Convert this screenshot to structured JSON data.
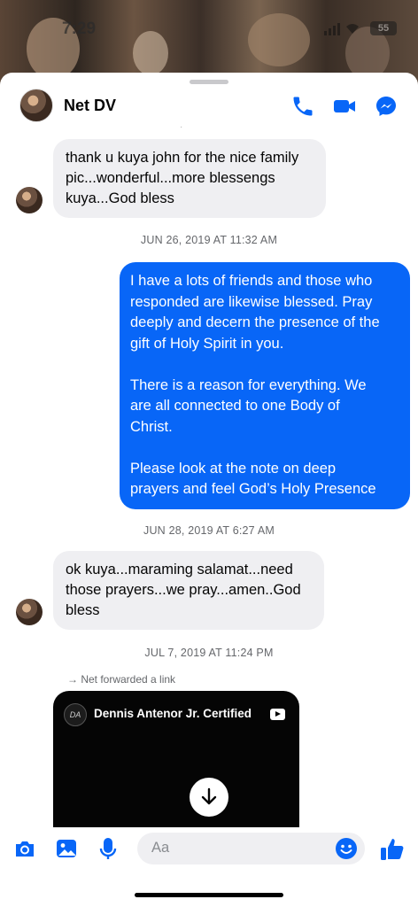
{
  "status_bar": {
    "time": "7:29",
    "battery": "55"
  },
  "header": {
    "contact_name": "Net DV"
  },
  "messages": {
    "m1": {
      "lines": [
        "thank u kuya john for the nice family",
        "pic...wonderful...more blessengs",
        "kuya...God bless"
      ]
    },
    "t1": "JUN 26, 2019 AT 11:32 AM",
    "m2": {
      "p1": [
        "I have a lots of friends and those who",
        "responded are likewise blessed. Pray",
        "deeply and decern the presence of the",
        "gift of Holy Spirit in you."
      ],
      "p2": [
        "There is a reason for everything. We",
        "are all connected to one Body of",
        "Christ."
      ],
      "p3": [
        "Please look at the note on deep",
        "prayers and feel God’s Holy Presence"
      ]
    },
    "t2": "JUN 28, 2019 AT 6:27 AM",
    "m3": {
      "lines": [
        "ok kuya...maraming salamat...need",
        "those prayers...we pray...amen..God",
        "bless"
      ]
    },
    "t3": "JUL 7, 2019 AT 11:24 PM",
    "forward_note": "→ Net forwarded a link",
    "card": {
      "title": "Dennis Antenor Jr. Certified",
      "logo_text": "DA"
    }
  },
  "composer": {
    "placeholder": "Aa"
  },
  "colors": {
    "accent": "#0866f7",
    "incoming_bubble": "#efeff2"
  },
  "icons": [
    "phone-icon",
    "video-icon",
    "messenger-icon",
    "camera-icon",
    "gallery-icon",
    "microphone-icon",
    "emoji-icon",
    "thumbs-up-icon",
    "download-icon",
    "youtube-icon"
  ]
}
